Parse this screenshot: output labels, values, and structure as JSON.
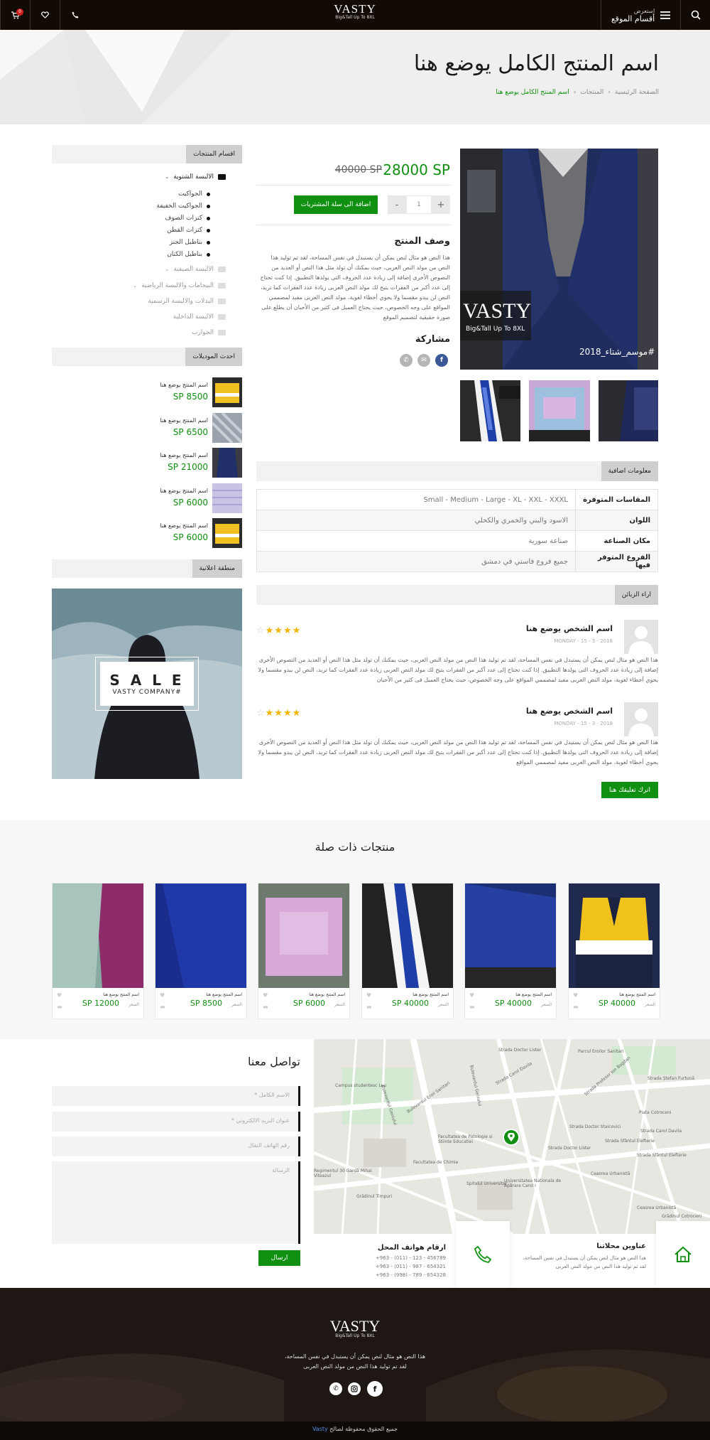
{
  "header": {
    "menu_top": "استعرض",
    "menu_bottom": "أقسام الموقع",
    "logo_text": "VASTY",
    "logo_sub": "Big&Tall Up To 8XL",
    "cart_count": "0"
  },
  "banner": {
    "title": "اسم المنتج الكامل يوضع هنا",
    "breadcrumb": [
      "الصفحة الرئيسية",
      "المنتجات",
      "اسم المنتج الكامل يوضع هنا"
    ]
  },
  "sidebar": {
    "categories_title": "اقسام المنتجات",
    "categories": [
      {
        "label": "الالبسة الشتوية",
        "level": 0,
        "expanded": true
      },
      {
        "label": "الجواكيت",
        "level": 1
      },
      {
        "label": "الجواكيت الخفيفة",
        "level": 1
      },
      {
        "label": "كنزات الصوف",
        "level": 1
      },
      {
        "label": "كنزات القطن",
        "level": 1
      },
      {
        "label": "بناطيل الجنز",
        "level": 1
      },
      {
        "label": "بناطيل الكتان",
        "level": 1
      },
      {
        "label": "الالبسة الصيفية",
        "level": 0
      },
      {
        "label": "البيجامات والالبسة الرياضية",
        "level": 0
      },
      {
        "label": "البدلات والالبسة الرسمية",
        "level": 0
      },
      {
        "label": "الالبسة الداخلية",
        "level": 0
      },
      {
        "label": "الجوارب",
        "level": 0
      }
    ],
    "recent_title": "احدث الموديلات",
    "recent": [
      {
        "name": "اسم المنتج يوضع هنا",
        "price": "8500 SP"
      },
      {
        "name": "اسم المنتج يوضع هنا",
        "price": "6500 SP"
      },
      {
        "name": "اسم المنتج يوضع هنا",
        "price": "21000 SP"
      },
      {
        "name": "اسم المنتج يوضع هنا",
        "price": "6000 SP"
      },
      {
        "name": "اسم المنتج يوضع هنا",
        "price": "6000 SP"
      }
    ],
    "ad_title": "منطقة اعلانية",
    "ad_main": "S A L E",
    "ad_sub": "#VASTY COMPANY"
  },
  "product": {
    "price_new": "28000 SP",
    "price_old": "40000 SP",
    "qty": "1",
    "add_to_cart": "اضافة الى سلة المشتريات",
    "desc_title": "وصف المنتج",
    "desc": "هذا النص هو مثال لنص يمكن أن يستبدل في نفس المساحة، لقد تم توليد هذا النص من مولد النص العربى، حيث يمكنك أن تولد مثل هذا النص أو العديد من النصوص الأخرى إضافة إلى زيادة عدد الحروف التى يولدها التطبيق. إذا كنت تحتاج إلى عدد أكبر من الفقرات يتيح لك مولد النص العربى زيادة عدد الفقرات كما تريد، النص لن يبدو مقسما ولا يحوي أخطاء لغوية، مولد النص العربى مفيد لمصممي المواقع على وجه الخصوص، حيث يحتاج العميل فى كثير من الأحيان أن يطلع على صورة حقيقية لتصميم الموقع",
    "share_title": "مشاركة",
    "image_hashtag": "#موسم_شتاء_2018",
    "image_logo": "VASTY",
    "image_logo_sub": "Big&Tall Up To 8XL"
  },
  "info": {
    "title": "معلومات اضافية",
    "rows": [
      {
        "key": "المقاسات المتوفرة",
        "value": "Small - Medium - Large - XL - XXL - XXXL"
      },
      {
        "key": "اللوان",
        "value": "الاسود والبني والخمري والكحلي"
      },
      {
        "key": "مكان الصناعة",
        "value": "صناعة سورية"
      },
      {
        "key": "الفروع المتوفر فيها",
        "value": "جميع فروع فاستي في دمشق"
      }
    ]
  },
  "reviews": {
    "title": "اراء الزبائن",
    "items": [
      {
        "name": "اسم الشخص يوضع هنا",
        "date": "MONDAY - 15 - 3 - 2018",
        "stars": 4,
        "text": "هذا النص هو مثال لنص يمكن أن يستبدل في نفس المساحة، لقد تم توليد هذا النص من مولد النص العربى، حيث يمكنك أن تولد مثل هذا النص أو العديد من النصوص الأخرى إضافة إلى زيادة عدد الحروف التى يولدها التطبيق. إذا كنت تحتاج إلى عدد أكبر من الفقرات يتيح لك مولد النص العربى زيادة عدد الفقرات كما تريد، النص لن يبدو مقسما ولا يحوي أخطاء لغوية، مولد النص العربى مفيد لمصممي المواقع على وجه الخصوص، حيث يحتاج العميل فى كثير من الأحيان"
      },
      {
        "name": "اسم الشخص يوضع هنا",
        "date": "MONDAY - 15 - 3 - 2018",
        "stars": 4,
        "text": "هذا النص هو مثال لنص يمكن أن يستبدل في نفس المساحة، لقد تم توليد هذا النص من مولد النص العربى، حيث يمكنك أن تولد مثل هذا النص أو العديد من النصوص الأخرى إضافة إلى زيادة عدد الحروف التى يولدها التطبيق. إذا كنت تحتاج إلى عدد أكبر من الفقرات يتيح لك مولد النص العربى زيادة عدد الفقرات كما تريد، النص لن يبدو مقسما ولا يحوي أخطاء لغوية، مولد النص العربى مفيد لمصممي المواقع"
      }
    ],
    "leave_comment": "اترك تعليقك هنا"
  },
  "related": {
    "title": "منتجات ذات صلة",
    "label": "السعر",
    "items": [
      {
        "name": "اسم المنتج يوضع هنا",
        "price": "40000 SP"
      },
      {
        "name": "اسم المنتج يوضع هنا",
        "price": "40000 SP"
      },
      {
        "name": "اسم المنتج يوضع هنا",
        "price": "40000 SP"
      },
      {
        "name": "اسم المنتج يوضع هنا",
        "price": "6000 SP"
      },
      {
        "name": "اسم المنتج يوضع هنا",
        "price": "8500 SP"
      },
      {
        "name": "اسم المنتج يوضع هنا",
        "price": "12000 SP"
      }
    ]
  },
  "contact": {
    "title": "تواصل معنا",
    "name_ph": "الاسم الكامل *",
    "email_ph": "عنوان البريد الالكتروني *",
    "phone_ph": "رقم الهاتف النقال",
    "msg_ph": "الرسالة",
    "send": "ارسال",
    "addr_title": "عناوين محلاتنا",
    "addr_text": "هذا النص هو مثال لنص يمكن أن يستبدل في نفس المساحة، لقد تم توليد هذا النص من مولد النص العربى",
    "phones_title": "ارقام هواتف المحل",
    "phones": [
      "+963 - (011) - 123 - 456789",
      "+963 - (011) - 987 - 654321",
      "+963 - (998) - 789 - 654328"
    ]
  },
  "map": {
    "labels": [
      "Parcul Eroilor Sanitari",
      "Campus studentesc Leu",
      "Facultatea de Patologie si Stiinte Educatiei",
      "Spitalul Universitar",
      "Universitatea Nationala de Apărare Carol I",
      "Facultatea de Chimie",
      "Regimentul 30 Gardă Mihai Viteazul",
      "Grădinul Timpuri",
      "Piata Cotroceni",
      "Grădinul Cotroceni",
      "Ceasrea Urbanistă",
      "Ceasrea Urbanistă",
      "Bulevardul Geniului",
      "Strada Doctor Lister",
      "Bulevardul Eroii Sanitari",
      "Strada Profesor Ion Bogdan",
      "Bulevardul Geniului",
      "Strada Ștefan Furtună",
      "Strada Doctor Staicovici",
      "Strada Doctor Lister",
      "Strada Sfântul Elefterie",
      "Strada Sfântul Elefterie",
      "Strada Carol Davila",
      "Strada Carol Davila"
    ]
  },
  "footer": {
    "logo_text": "VASTY",
    "logo_sub": "Big&Tall Up To 8XL",
    "text1": "هذا النص هو مثال لنص يمكن أن يستبدل في نفس المساحة،",
    "text2": "لقد تم توليد هذا النص من مولد النص العربى",
    "copyright_pre": "جميع الحقوق محفوظة لصالح",
    "copyright_brand": "Vasty"
  },
  "colors": {
    "accent": "#109010",
    "dark": "#120a05",
    "facebook": "#3b5998"
  }
}
